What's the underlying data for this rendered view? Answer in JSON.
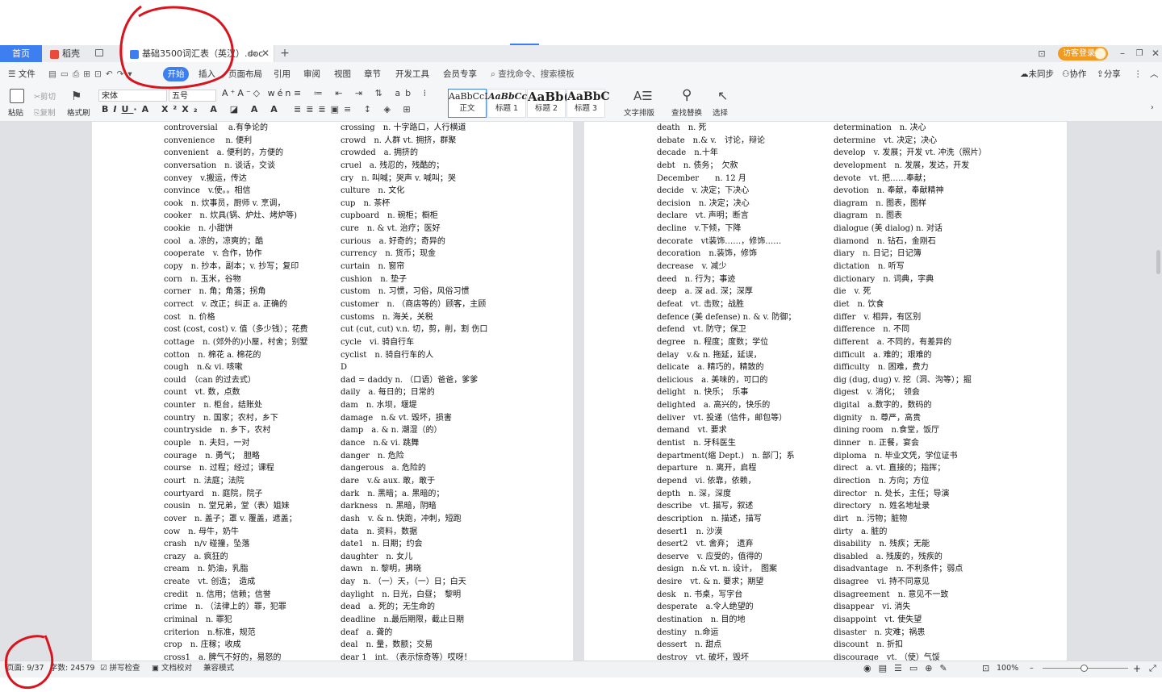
{
  "tabs": {
    "home": "首页",
    "docer": "稻壳",
    "document_title": "基础3500词汇表（英汉）.doc",
    "new_tab": "+",
    "login": "访客登录"
  },
  "menu": {
    "file": "文件",
    "items": [
      "开始",
      "插入",
      "页面布局",
      "引用",
      "审阅",
      "视图",
      "章节",
      "开发工具",
      "会员专享"
    ],
    "search": "查找命令、搜索模板",
    "sync": "未同步",
    "collab": "协作",
    "share": "分享"
  },
  "ribbon": {
    "paste": "粘贴",
    "cut": "剪切",
    "copy": "复制",
    "format_painter": "格式刷",
    "font_name": "宋体",
    "font_size": "五号",
    "styles": [
      {
        "sample": "AaBbCcDd",
        "name": "正文"
      },
      {
        "sample": "AaBbCcDd",
        "name": "标题 1"
      },
      {
        "sample": "AaBb(",
        "name": "标题 2"
      },
      {
        "sample": "AaBbC",
        "name": "标题 3"
      }
    ],
    "text_layout": "文字排版",
    "find_replace": "查找替换",
    "select": "选择"
  },
  "document": {
    "col1": [
      "controversial　 a.有争论的",
      "convenience　 n. 便利",
      "convenient　a. 便利的，方便的",
      "conversation　n. 谈话，交谈",
      "convey　v.搬运，传达",
      "convince　v.使。。相信",
      "cook　n. 炊事员，厨师 v. 烹调，",
      "cooker　n. 炊具(锅、炉灶、烤炉等)",
      "cookie　n. 小甜饼",
      "cool　a. 凉的，凉爽的；酷",
      "cooperate　v. 合作，协作",
      "copy　n. 抄本，副本；v. 抄写；复印",
      "corn　n. 玉米，谷物",
      "corner　n. 角；角落；拐角",
      "correct　v. 改正；纠正 a. 正确的",
      "cost　n. 价格",
      "cost (cost, cost) v. 值（多少钱）；花费",
      "cottage　n. (郊外的)小屋，村舍；别墅",
      "cotton　n. 棉花 a. 棉花的",
      "cough　n.& vi. 咳嗽",
      "could　（can 的过去式）",
      "count　vt. 数，点数",
      "counter　n. 柜台，结账处",
      "country　n. 国家；农村，乡下",
      "countryside　n. 乡下，农村",
      "couple　n. 夫妇，一对",
      "courage　n. 勇气；　胆略",
      "course　n. 过程；经过；课程",
      "court　n. 法庭；法院",
      "courtyard　n. 庭院，院子",
      "cousin　n. 堂兄弟，堂（表）姐妹",
      "cover　n. 盖子；罩 v. 覆盖，遮盖；",
      "cow　n. 母牛，奶牛",
      "crash　n/v 碰撞，坠落",
      "crazy　a. 疯狂的",
      "cream　n. 奶油，乳脂",
      "create　vt. 创造；　造成",
      "credit　n. 信用；信赖；信誉",
      "crime　n. （法律上的）罪，犯罪",
      "criminal　n. 罪犯",
      "criterion　n.标准，规范",
      "crop　n. 庄稼；收成",
      "cross1　a. 脾气不好的，易怒的"
    ],
    "col2": [
      "crossing　n. 十字路口，人行横道",
      "crowd　n. 人群 vt. 拥挤，群聚",
      "crowded　a. 拥挤的",
      "cruel　a. 残忍的，残酷的；",
      "cry　n. 叫喊；哭声 v. 喊叫；哭",
      "culture　n. 文化",
      "cup　n. 茶杯",
      "cupboard　n. 碗柜；橱柜",
      "cure　n. & vt. 治疗；医好",
      "curious　a. 好奇的；奇异的",
      "currency　n. 货币；现金",
      "curtain　n. 窗帘",
      "cushion　n. 垫子",
      "custom　n. 习惯，习俗，风俗习惯",
      "customer　n. （商店等的）顾客，主顾",
      "customs　n. 海关，关税",
      "cut (cut, cut) v.n. 切，剪，削，割 伤口",
      "cycle　vi. 骑自行车",
      "cyclist　n. 骑自行车的人",
      "D",
      "dad = daddy n. （口语）爸爸，爹爹",
      "daily　a. 每日的；日常的",
      "dam　n. 水坝，堰堤",
      "damage　n.& vt. 毁坏，损害",
      "damp　a. & n. 潮湿（的）",
      "dance　n.& vi. 跳舞",
      "danger　n. 危险",
      "dangerous　a. 危险的",
      "dare　v.& aux. 敢，敢于",
      "dark　n. 黑暗；a. 黑暗的；",
      "darkness　n. 黑暗，阴暗",
      "dash　v. & n. 快跑，冲刺，短跑",
      "data　n. 资料，数据",
      "date1　n. 日期；约会",
      "daughter　n. 女儿",
      "dawn　n. 黎明，拂晓",
      "day　n. （一）天，（一）日；白天",
      "daylight　n. 日光，白昼；　黎明",
      "dead　a. 死的；无生命的",
      "deadline　n.最后期限，截止日期",
      "deaf　a. 聋的",
      "deal　n. 量，数额；交易",
      "dear 1　int. （表示惊奇等）哎呀！"
    ],
    "col3": [
      "death　n. 死",
      "debate　n.& v.　讨论，辩论",
      "decade　n.十年",
      "debt　n. 债务；　欠款",
      "December　　n. 12 月",
      "decide　v. 决定；下决心",
      "decision　n. 决定；决心",
      "declare　vt. 声明；断言",
      "decline　v.下倾，下降",
      "decorate　vt装饰……，修饰……",
      "decoration　n.装饰，修饰",
      "decrease　v. 减少",
      "deed　n. 行为；事迹",
      "deep　a. 深 ad. 深；深厚",
      "defeat　vt. 击败；战胜",
      "defence (美 defense) n. & v. 防御；",
      "defend　vt. 防守；保卫",
      "degree　n. 程度；度数；学位",
      "delay　v.& n. 拖延，延误，",
      "delicate　a. 精巧的，精致的",
      "delicious　a. 美味的，可口的",
      "delight　n. 快乐；　乐事",
      "delighted　a. 高兴的，快乐的",
      "deliver　vt. 投递（信件，邮包等）",
      "demand　vt. 要求",
      "dentist　n. 牙科医生",
      "department(缩 Dept.)　n. 部门；系",
      "departure　n. 离开，启程",
      "depend　vi. 依靠，依赖，",
      "depth　n. 深，深度",
      "describe　vt. 描写，叙述",
      "description　n. 描述，描写",
      "desert1　n. 沙漠",
      "desert2　vt. 舍弃；　遗弃",
      "deserve　v. 应受的，值得的",
      "design　n.& vt. n. 设计，　图案",
      "desire　vt. & n. 要求；期望",
      "desk　n. 书桌，写字台",
      "desperate　a.令人绝望的",
      "destination　n. 目的地",
      "destiny　n.命运",
      "dessert　n. 甜点",
      "destroy　vt. 破坏，毁坏"
    ],
    "col4": [
      "determination　n. 决心",
      "determine　vt. 决定；决心",
      "develop　v. 发展；开发 vt. 冲洗（照片）",
      "development　n. 发展，发达，开发",
      "devote　vt. 把……奉献；",
      "devotion　n. 奉献，奉献精神",
      "diagram　n. 图表，图样",
      "diagram　n. 图表",
      "dialogue (美 dialog) n. 对话",
      "diamond　n. 钻石，金刚石",
      "diary　n. 日记；日记簿",
      "dictation　n. 听写",
      "dictionary　n. 词典，字典",
      "die　v. 死",
      "diet　n. 饮食",
      "differ　v. 相异，有区别",
      "difference　n. 不同",
      "different　a. 不同的，有差异的",
      "difficult　a. 难的；艰难的",
      "difficulty　n. 困难，费力",
      "dig (dug, dug) v. 挖（洞、沟等）；掘",
      "digest　v. 消化；　领会",
      "digital　a.数字的，数码的",
      "dignity　n. 尊严，高贵",
      "dining room　n.食堂，饭厅",
      "dinner　n. 正餐，宴会",
      "diploma　n. 毕业文凭，学位证书",
      "direct　a. vt. 直接的；指挥；",
      "direction　n. 方向；方位",
      "director　n. 处长，主任；导演",
      "directory　n. 姓名地址录",
      "dirt　n. 污物；脏物",
      "dirty　a. 脏的",
      "disability　n. 残疾；无能",
      "disabled　a. 残废的，残疾的",
      "disadvantage　n. 不利条件；弱点",
      "disagree　vi. 持不同意见",
      "disagreement　n. 意见不一致",
      "disappear　vi. 消失",
      "disappoint　vt. 使失望",
      "disaster　n. 灾难；祸患",
      "discount　n. 折扣",
      "discourage　vt. （使）气馁"
    ]
  },
  "status": {
    "page": "页面: 9/37",
    "words": "字数: 24579",
    "spell_check": "拼写检查",
    "doc_proof": "文档校对",
    "compat": "兼容模式",
    "zoom": "100%"
  }
}
